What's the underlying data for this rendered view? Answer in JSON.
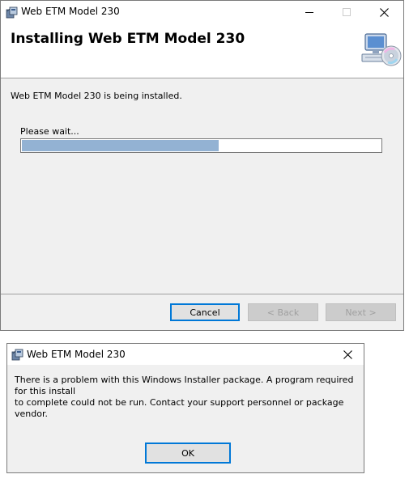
{
  "installer": {
    "title": "Web ETM Model 230",
    "heading": "Installing Web ETM Model 230",
    "status_text": "Web ETM Model 230 is being installed.",
    "progress_label": "Please wait...",
    "progress_value": 0.55,
    "buttons": {
      "cancel": "Cancel",
      "back": "< Back",
      "next": "Next >"
    }
  },
  "error_dialog": {
    "title": "Web ETM Model 230",
    "message_line1": "There is a problem with this Windows Installer package. A program required for this install",
    "message_line2": "to complete could not be run. Contact your support personnel or package vendor.",
    "ok_label": "OK"
  },
  "colors": {
    "progress_fill": "#93b2d3",
    "default_button_border": "#0078d7"
  },
  "icons": [
    "installer-app-icon",
    "minimize-icon",
    "maximize-icon",
    "close-icon",
    "computer-cd-icon"
  ]
}
